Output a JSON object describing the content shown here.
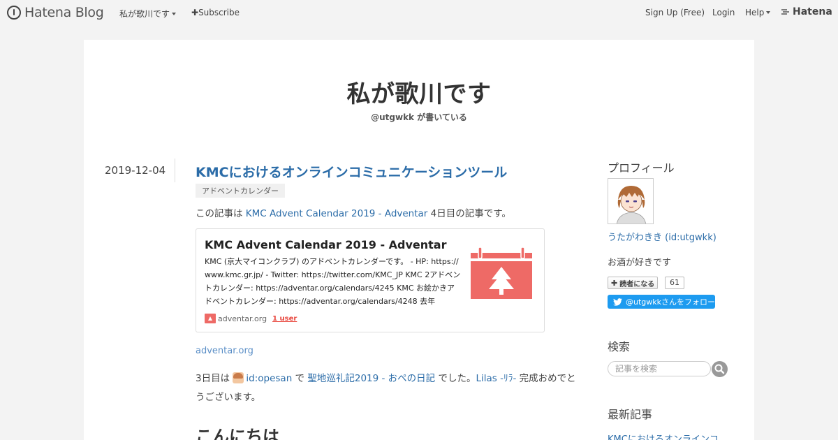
{
  "global_header": {
    "logo_text": "Hatena Blog",
    "blog_menu": "私が歌川です",
    "subscribe": "Subscribe",
    "signup": "Sign Up (Free)",
    "login": "Login",
    "help": "Help",
    "hatena": "Hatena"
  },
  "blog": {
    "title": "私が歌川です",
    "description": "@utgwkk が書いている"
  },
  "entry": {
    "date": "2019-12-04",
    "title": "KMCにおけるオンラインコミュニケーションツール",
    "category": "アドベントカレンダー",
    "intro_before": "この記事は ",
    "intro_link": "KMC Advent Calendar 2019 - Adventar",
    "intro_after": " 4日目の記事です。",
    "embed": {
      "title": "KMC Advent Calendar 2019 - Adventar",
      "description": "KMC (京大マイコンクラブ) のアドベントカレンダーです。 - HP: https://www.kmc.gr.jp/ - Twitter: https://twitter.com/KMC_JP KMC 2アドベントカレンダー: https://adventar.org/calendars/4245 KMC お絵かきアドベントカレンダー: https://adventar.org/calendars/4248 去年",
      "domain": "adventar.org",
      "users": "1 user"
    },
    "source_link": "adventar.org",
    "p2_before": "3日目は ",
    "p2_user": "id:opesan",
    "p2_mid": " で ",
    "p2_link1": "聖地巡礼記2019 - おぺの日記",
    "p2_mid2": " でした。",
    "p2_link2": "Lilas -ﾘﾗ-",
    "p2_after": " 完成おめでとうございます。",
    "heading": "こんにちは"
  },
  "sidebar": {
    "profile_heading": "プロフィール",
    "profile_name": "うたがわきき (id:utgwkk)",
    "profile_desc": "お酒が好きです",
    "subscribe_btn": "読者になる",
    "subscriber_count": "61",
    "twitter_follow": "@utgwkkさんをフォロー",
    "search_heading": "検索",
    "search_placeholder": "記事を検索",
    "recent_heading": "最新記事",
    "recent_item": "KMCにおけるオンラインコ"
  },
  "colors": {
    "link": "#2b6ca8",
    "adventar_red": "#ee6a66",
    "twitter_blue": "#1d9bf0"
  }
}
